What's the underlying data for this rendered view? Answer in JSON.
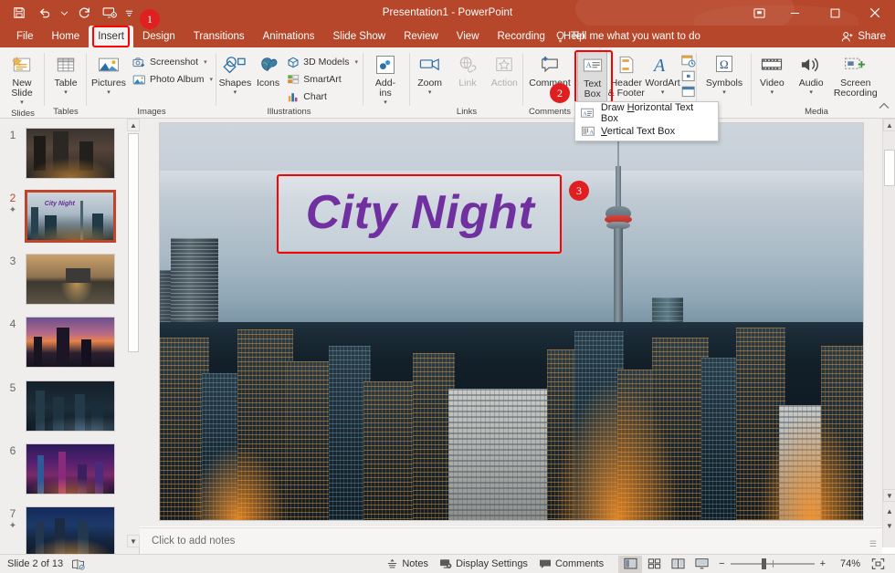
{
  "titlebar": {
    "document_title": "Presentation1  -  PowerPoint",
    "qat": [
      {
        "name": "save-icon",
        "glyph": "Ὃe"
      },
      {
        "name": "undo-icon",
        "glyph": "↶"
      },
      {
        "name": "undo-dropdown-caret",
        "glyph": "⌄"
      },
      {
        "name": "redo-icon",
        "glyph": "↻"
      },
      {
        "name": "start-from-beginning-icon",
        "glyph": "▷"
      },
      {
        "name": "customize-quick-access-toolbar-caret",
        "glyph": "⌄"
      }
    ],
    "window_controls": {
      "ribbon_display_options": "⬒",
      "minimize": "—",
      "maximize": "□",
      "close": "✕"
    }
  },
  "tabs": [
    {
      "label": "File",
      "active": false
    },
    {
      "label": "Home",
      "active": false
    },
    {
      "label": "Insert",
      "active": true
    },
    {
      "label": "Design",
      "active": false
    },
    {
      "label": "Transitions",
      "active": false
    },
    {
      "label": "Animations",
      "active": false
    },
    {
      "label": "Slide Show",
      "active": false
    },
    {
      "label": "Review",
      "active": false
    },
    {
      "label": "View",
      "active": false
    },
    {
      "label": "Recording",
      "active": false
    },
    {
      "label": "Help",
      "active": false
    }
  ],
  "tellme": {
    "placeholder": "Tell me what you want to do"
  },
  "share": {
    "label": "Share"
  },
  "ribbon": {
    "groups": [
      {
        "name": "Slides",
        "label": "Slides",
        "buttons": [
          {
            "label": "New\nSlide",
            "caret": true
          }
        ]
      },
      {
        "name": "Tables",
        "label": "Tables",
        "buttons": [
          {
            "label": "Table",
            "caret": true
          }
        ]
      },
      {
        "name": "Images",
        "label": "Images",
        "buttons": [
          {
            "label": "Pictures",
            "caret": true
          }
        ],
        "small_buttons": [
          {
            "label": "Screenshot",
            "caret": true
          },
          {
            "label": "Photo Album",
            "caret": true
          }
        ]
      },
      {
        "name": "Illustrations",
        "label": "Illustrations",
        "buttons": [
          {
            "label": "Shapes",
            "caret": true
          },
          {
            "label": "Icons",
            "caret": false
          }
        ],
        "small_buttons": [
          {
            "label": "3D Models",
            "caret": true
          },
          {
            "label": "SmartArt",
            "caret": false
          },
          {
            "label": "Chart",
            "caret": false
          }
        ]
      },
      {
        "name": "Add-ins",
        "label": "",
        "buttons": [
          {
            "label": "Add-\nins",
            "caret": true
          }
        ]
      },
      {
        "name": "Links",
        "label": "Links",
        "buttons": [
          {
            "label": "Zoom",
            "caret": true,
            "disabled": false
          },
          {
            "label": "Link",
            "caret": false,
            "disabled": true
          },
          {
            "label": "Action",
            "caret": false,
            "disabled": true
          }
        ]
      },
      {
        "name": "Comments",
        "label": "Comments",
        "buttons": [
          {
            "label": "Comment",
            "caret": false
          }
        ]
      },
      {
        "name": "Text",
        "label": "",
        "buttons": [
          {
            "label": "Text\nBox",
            "caret": true,
            "selected": true
          },
          {
            "label": "Header\n& Footer",
            "caret": false
          },
          {
            "label": "WordArt",
            "caret": true
          }
        ]
      },
      {
        "name": "Symbols",
        "label": "",
        "buttons": [
          {
            "label": "Symbols",
            "caret": true
          }
        ]
      },
      {
        "name": "Media",
        "label": "Media",
        "buttons": [
          {
            "label": "Video",
            "caret": true
          },
          {
            "label": "Audio",
            "caret": true
          },
          {
            "label": "Screen\nRecording",
            "caret": false
          }
        ]
      }
    ]
  },
  "textbox_menu": {
    "items": [
      {
        "label_pre": "Draw ",
        "label_key": "H",
        "label_post": "orizontal Text Box",
        "icon": "horizontal-text-box-icon"
      },
      {
        "label_pre": "",
        "label_key": "V",
        "label_post": "ertical Text Box",
        "icon": "vertical-text-box-icon"
      }
    ]
  },
  "annotations": {
    "badges": [
      {
        "number": "1",
        "target": "insert-tab"
      },
      {
        "number": "2",
        "target": "text-box-button"
      },
      {
        "number": "3",
        "target": "slide-text-box"
      }
    ],
    "color": "#ff0000",
    "badge_color": "#e02020"
  },
  "thumbnails": {
    "items": [
      {
        "number": "1",
        "starred": false,
        "current": false,
        "title": ""
      },
      {
        "number": "2",
        "starred": true,
        "current": true,
        "title": "City Night"
      },
      {
        "number": "3",
        "starred": false,
        "current": false,
        "title": ""
      },
      {
        "number": "4",
        "starred": false,
        "current": false,
        "title": ""
      },
      {
        "number": "5",
        "starred": false,
        "current": false,
        "title": ""
      },
      {
        "number": "6",
        "starred": false,
        "current": false,
        "title": ""
      },
      {
        "number": "7",
        "starred": true,
        "current": false,
        "title": ""
      }
    ]
  },
  "slide": {
    "textbox_text": "City Night",
    "textbox_text_color": "#7030a0"
  },
  "notes": {
    "placeholder": "Click to add notes"
  },
  "statusbar": {
    "slide_counter": "Slide 2 of 13",
    "accessibility_icon": "accessibility-checker-icon",
    "notes_label": "Notes",
    "display_settings_label": "Display Settings",
    "comments_label": "Comments",
    "views": [
      {
        "name": "normal-view-button",
        "active": true
      },
      {
        "name": "slide-sorter-view-button",
        "active": false
      },
      {
        "name": "reading-view-button",
        "active": false
      },
      {
        "name": "slide-show-button",
        "active": false
      }
    ],
    "zoom_out": "−",
    "zoom_in": "+",
    "zoom_percent": "74%",
    "fit_to_window": "fit-slide-to-window-icon"
  },
  "colors": {
    "accent": "#b7472a",
    "ribbon_bg": "#f3f2f1",
    "pane_bg": "#f0eeed"
  }
}
